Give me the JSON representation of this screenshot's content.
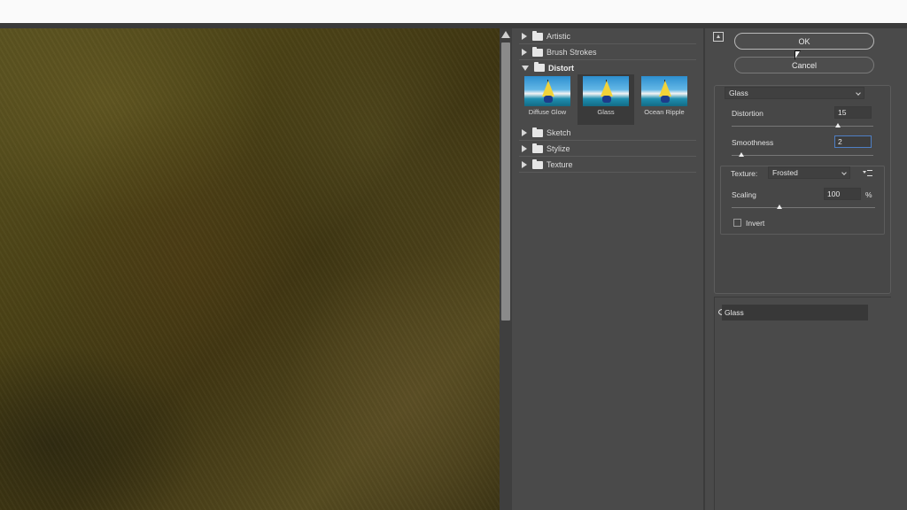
{
  "gallery": {
    "categories": [
      {
        "label": "Artistic",
        "expanded": false
      },
      {
        "label": "Brush Strokes",
        "expanded": false
      },
      {
        "label": "Distort",
        "expanded": true
      },
      {
        "label": "Sketch",
        "expanded": false
      },
      {
        "label": "Stylize",
        "expanded": false
      },
      {
        "label": "Texture",
        "expanded": false
      }
    ],
    "thumbnails": [
      {
        "label": "Diffuse Glow",
        "selected": false
      },
      {
        "label": "Glass",
        "selected": true
      },
      {
        "label": "Ocean Ripple",
        "selected": false
      }
    ]
  },
  "buttons": {
    "ok_label": "OK",
    "cancel_label": "Cancel"
  },
  "settings": {
    "filter_selected": "Glass",
    "distortion": {
      "label": "Distortion",
      "value": "15",
      "level": 15,
      "max": 20
    },
    "smoothness": {
      "label": "Smoothness",
      "value": "2",
      "level": 2,
      "max": 15
    },
    "texture": {
      "label": "Texture:",
      "selected": "Frosted"
    },
    "scaling": {
      "label": "Scaling",
      "value": "100",
      "unit": "%",
      "level": 100,
      "min": 50,
      "max": 200
    },
    "invert": {
      "label": "Invert",
      "checked": false
    }
  },
  "layers": {
    "items": [
      {
        "label": "Glass",
        "visible": true
      }
    ]
  }
}
